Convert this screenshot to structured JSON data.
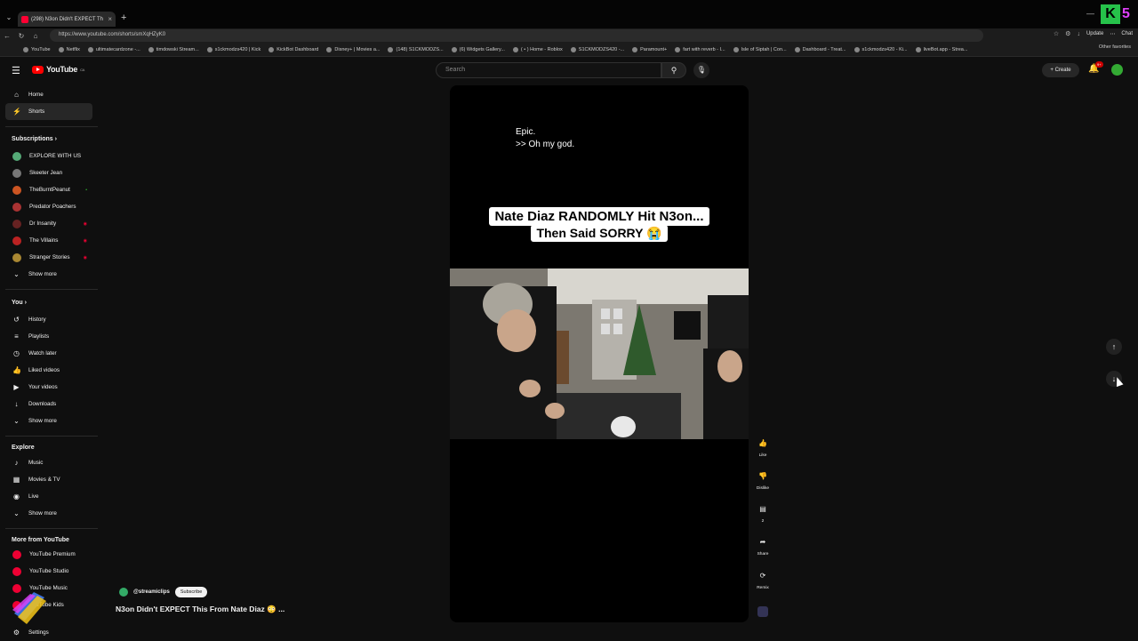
{
  "browser": {
    "tab_title": "(298) N3on Didn't EXPECT Th",
    "url": "https://www.youtube.com/shorts/smXqHZyK0",
    "update_label": "Update",
    "chat_label": "Chat",
    "bookmarks": [
      "YouTube",
      "Netflix",
      "ultimatecardzone -...",
      "timdowski Stream...",
      "s1ckmodzs420 | Kick",
      "KickBot Dashboard",
      "Disney+ | Movies a...",
      "(148) S1CKMODZS...",
      "(6) Widgets Gallery...",
      "( • ) Home - Roblox",
      "S1CKMODZS420 -...",
      "Paramount+",
      "fart with reverb - I...",
      "Isle of Siptah | Con...",
      "Dashboard - Treat...",
      "s1ckmodzs420 - Ki...",
      "liveBot.app - Strea..."
    ],
    "other_favorites": "Other favorites"
  },
  "header": {
    "logo_text": "YouTube",
    "logo_country": "CA",
    "search_placeholder": "Search",
    "create_label": "Create",
    "notification_count": "9+"
  },
  "sidebar": {
    "main": [
      {
        "label": "Home",
        "icon": "home-icon"
      },
      {
        "label": "Shorts",
        "icon": "shorts-icon",
        "active": true
      }
    ],
    "subscriptions_title": "Subscriptions",
    "subscriptions": [
      {
        "label": "EXPLORE WITH US",
        "color": "#5a7"
      },
      {
        "label": "Skeeter Jean",
        "color": "#777"
      },
      {
        "label": "TheBurntPeanut",
        "color": "#c52"
      },
      {
        "label": "Predator Poachers",
        "color": "#a33"
      },
      {
        "label": "Dr Insanity",
        "color": "#622"
      },
      {
        "label": "The Villains",
        "color": "#b22"
      },
      {
        "label": "Stranger Stories",
        "color": "#a83"
      }
    ],
    "show_more": "Show more",
    "you_title": "You",
    "you_items": [
      {
        "label": "History",
        "icon": "history-icon"
      },
      {
        "label": "Playlists",
        "icon": "playlists-icon"
      },
      {
        "label": "Watch later",
        "icon": "watch-later-icon"
      },
      {
        "label": "Liked videos",
        "icon": "liked-videos-icon"
      },
      {
        "label": "Your videos",
        "icon": "your-videos-icon"
      },
      {
        "label": "Downloads",
        "icon": "downloads-icon"
      }
    ],
    "explore_title": "Explore",
    "explore_items": [
      {
        "label": "Music",
        "icon": "music-icon"
      },
      {
        "label": "Movies & TV",
        "icon": "movies-icon"
      },
      {
        "label": "Live",
        "icon": "live-icon"
      }
    ],
    "more_title": "More from YouTube",
    "more_items": [
      {
        "label": "YouTube Premium"
      },
      {
        "label": "YouTube Studio"
      },
      {
        "label": "YouTube Music"
      },
      {
        "label": "YouTube Kids"
      }
    ],
    "settings": "Settings"
  },
  "short": {
    "caption": "Epic.",
    "caption2": ">> Oh my god.",
    "title_line1": "Nate Diaz RANDOMLY Hit N3on...",
    "title_line2": "Then Said SORRY 😭",
    "channel": "@streamiclips",
    "subscribe_label": "Subscribe",
    "video_title": "N3on Didn't EXPECT This From Nate Diaz 😳 ...",
    "actions": [
      {
        "label": "Like",
        "icon": "like-icon"
      },
      {
        "label": "Dislike",
        "icon": "dislike-icon"
      },
      {
        "label": "2",
        "icon": "comments-icon"
      },
      {
        "label": "Share",
        "icon": "share-icon"
      },
      {
        "label": "Remix",
        "icon": "remix-icon"
      }
    ]
  },
  "colors": {
    "background": "#0f0f0f",
    "accent": "#ff0000"
  }
}
